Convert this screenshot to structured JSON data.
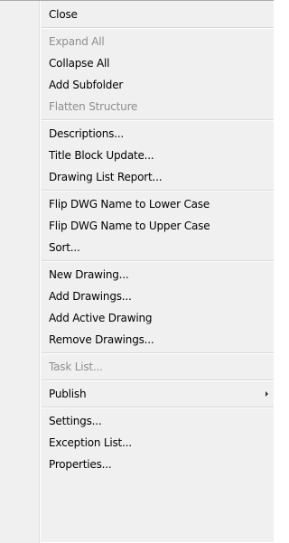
{
  "menu": {
    "groups": [
      [
        {
          "label": "Close",
          "disabled": false
        }
      ],
      [
        {
          "label": "Expand All",
          "disabled": true
        },
        {
          "label": "Collapse All",
          "disabled": false
        },
        {
          "label": "Add Subfolder",
          "disabled": false
        },
        {
          "label": "Flatten Structure",
          "disabled": true
        }
      ],
      [
        {
          "label": "Descriptions...",
          "disabled": false
        },
        {
          "label": "Title Block Update...",
          "disabled": false
        },
        {
          "label": "Drawing List Report...",
          "disabled": false
        }
      ],
      [
        {
          "label": "Flip DWG Name to Lower Case",
          "disabled": false
        },
        {
          "label": "Flip DWG Name to Upper Case",
          "disabled": false
        },
        {
          "label": "Sort...",
          "disabled": false
        }
      ],
      [
        {
          "label": "New Drawing...",
          "disabled": false
        },
        {
          "label": "Add Drawings...",
          "disabled": false
        },
        {
          "label": "Add Active Drawing",
          "disabled": false
        },
        {
          "label": "Remove Drawings...",
          "disabled": false
        }
      ],
      [
        {
          "label": "Task List...",
          "disabled": true
        }
      ],
      [
        {
          "label": "Publish",
          "disabled": false,
          "submenu_icon": "submenu-arrow-icon"
        }
      ],
      [
        {
          "label": "Settings...",
          "disabled": false
        },
        {
          "label": "Exception List...",
          "disabled": false
        },
        {
          "label": "Properties...",
          "disabled": false
        }
      ]
    ]
  },
  "colors": {
    "background": "#f0f0f0",
    "text": "#000000",
    "disabled_text": "#8e8e8e",
    "separator": "#d8d8d8"
  }
}
